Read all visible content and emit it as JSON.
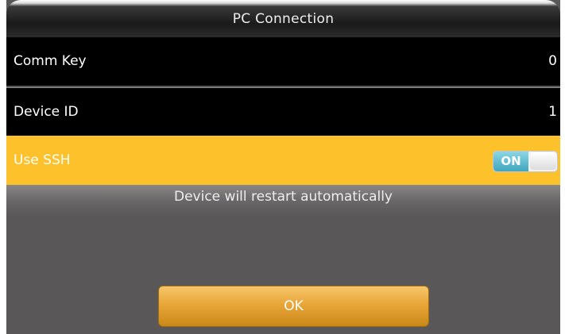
{
  "header": {
    "title": "PC Connection"
  },
  "settings": {
    "items": [
      {
        "label": "Comm Key",
        "value": "0"
      },
      {
        "label": "Device ID",
        "value": "1"
      },
      {
        "label": "Use SSH",
        "toggle_label": "ON",
        "toggle_state": "on"
      }
    ]
  },
  "message": "Device will restart automatically",
  "buttons": {
    "ok_label": "OK"
  },
  "colors": {
    "highlight": "#fcc12b",
    "toggle_on": "#3fa6bd",
    "button": "#e8a638"
  }
}
